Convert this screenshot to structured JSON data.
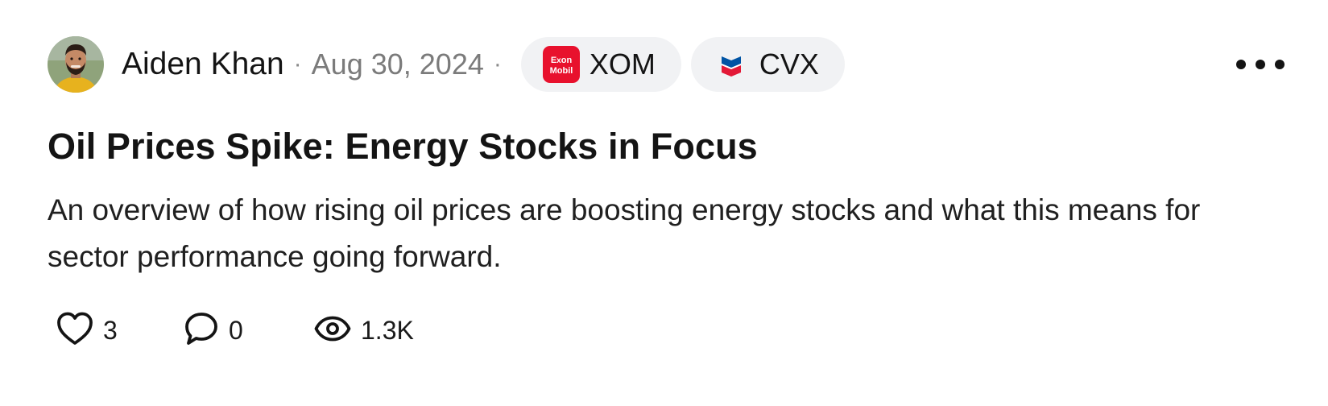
{
  "post": {
    "author": "Aiden Khan",
    "date": "Aug 30, 2024",
    "separator": "·",
    "tickers": [
      {
        "symbol": "XOM",
        "logo_text_top": "E",
        "logo_text_top2": "xon",
        "logo_text_bottom": "Mobil",
        "logo_color": "#e8112d"
      },
      {
        "symbol": "CVX",
        "logo_colors": [
          "#0054a4",
          "#e31937"
        ]
      }
    ],
    "title": "Oil Prices Spike: Energy Stocks in Focus",
    "summary": "An overview of how rising oil prices are boosting energy stocks and what this means for sector performance going forward.",
    "stats": {
      "likes": "3",
      "comments": "0",
      "views": "1.3K"
    },
    "icons": {
      "like": "heart-icon",
      "comment": "comment-icon",
      "views": "eye-icon",
      "more": "more-options-icon"
    }
  }
}
